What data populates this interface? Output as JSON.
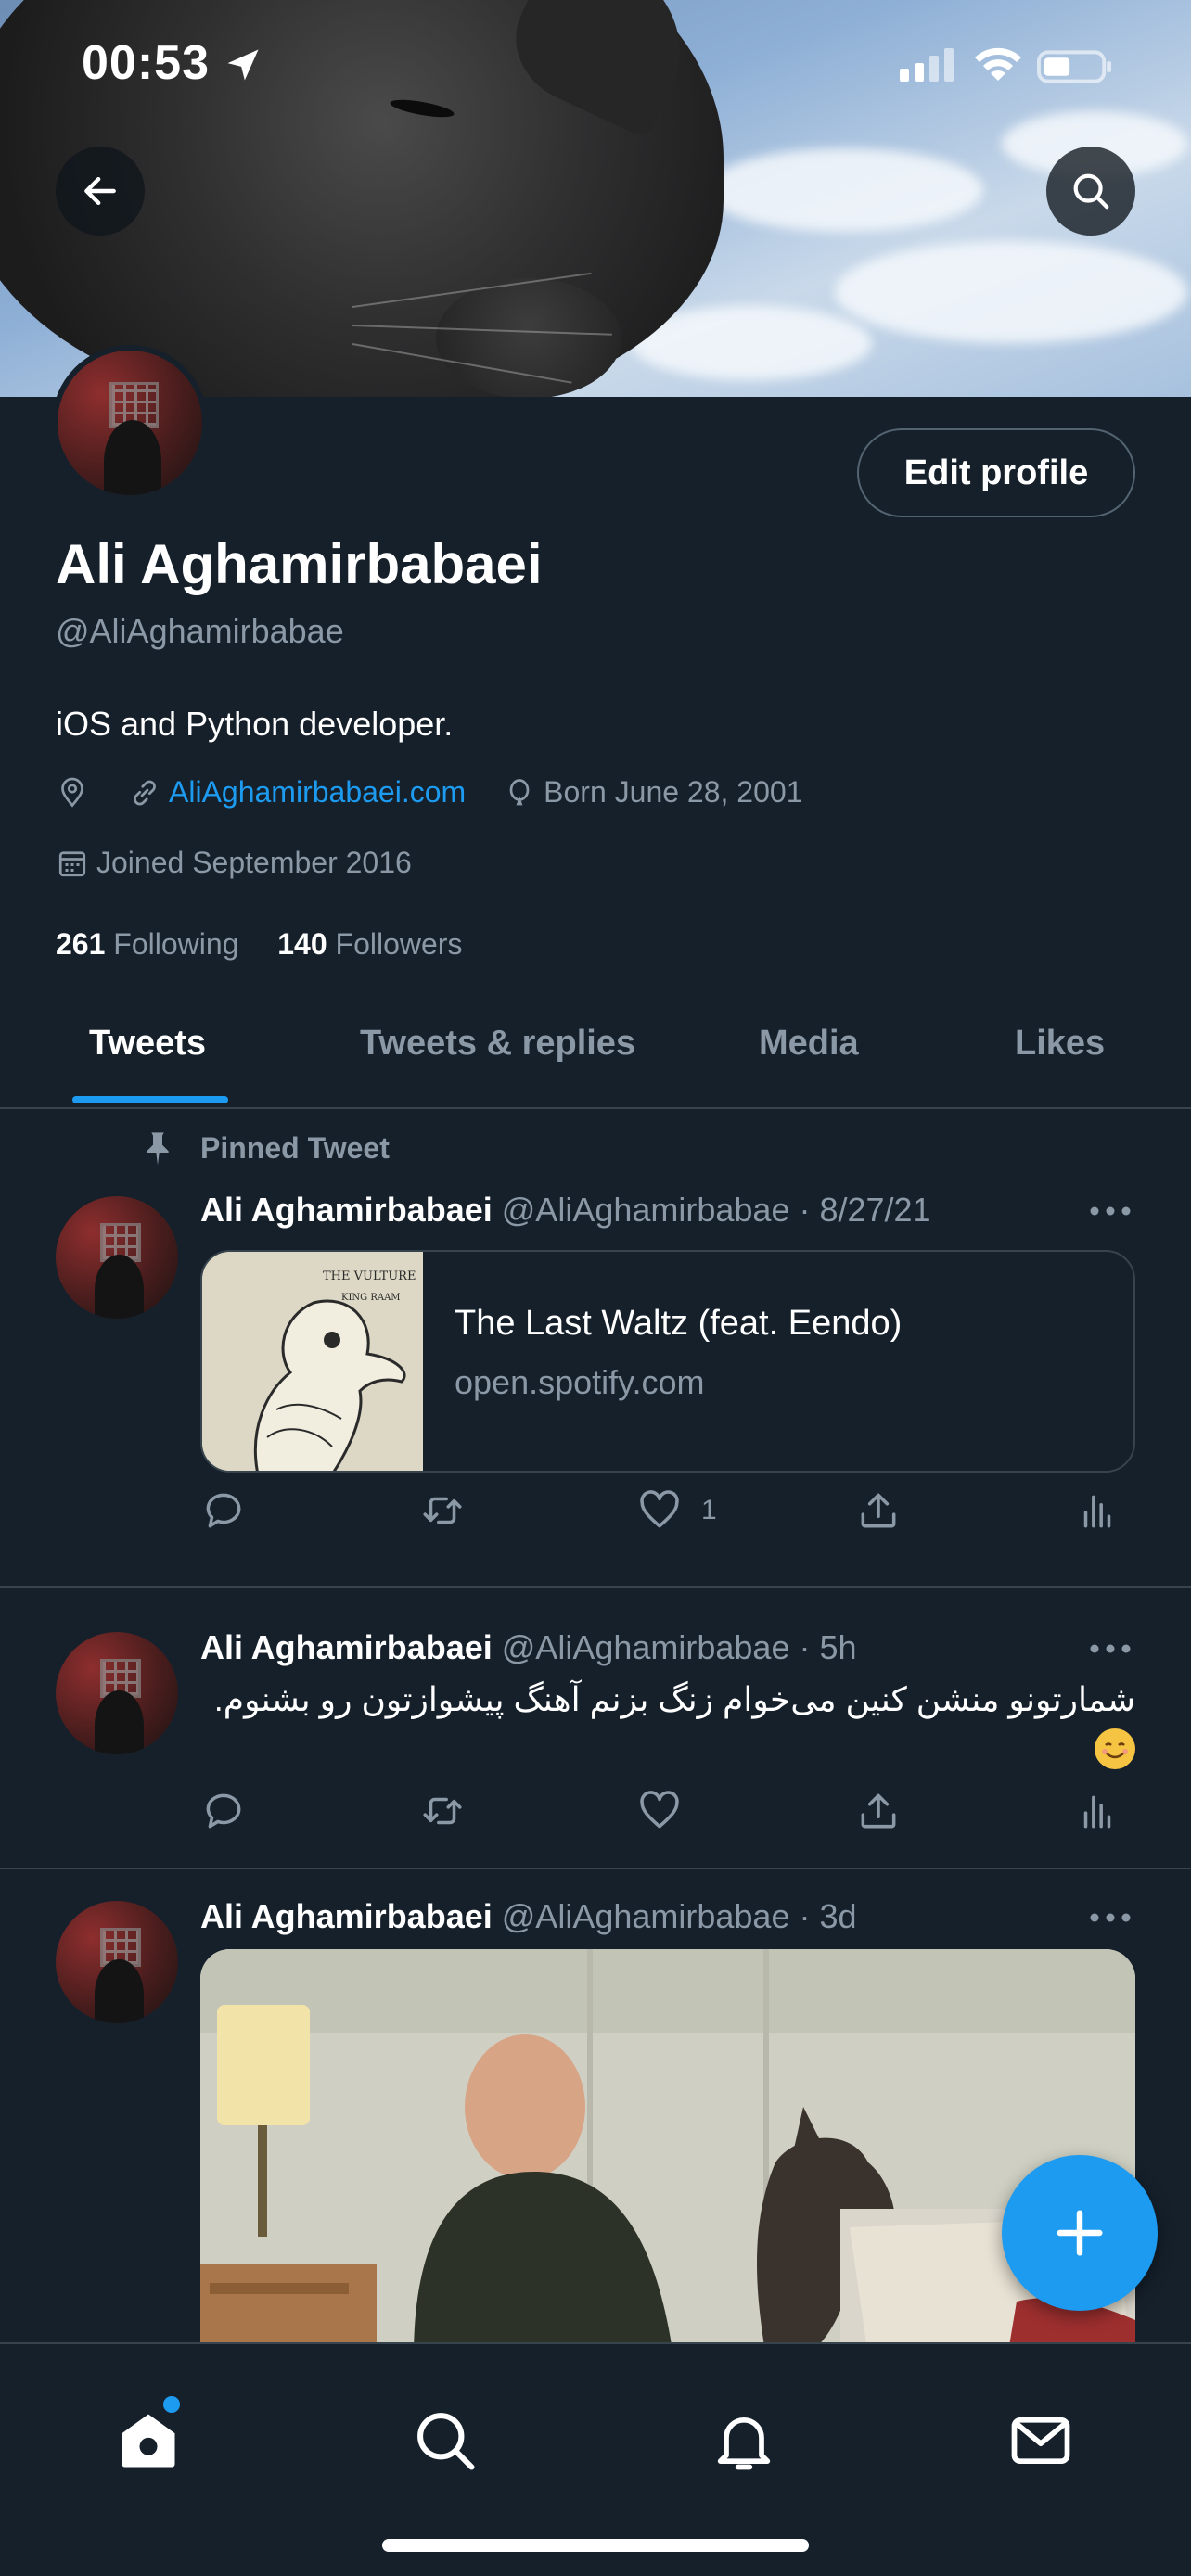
{
  "status": {
    "time": "00:53"
  },
  "profile": {
    "name": "Ali Aghamirbabaei",
    "handle": "@AliAghamirbabae",
    "bio": "iOS and Python developer.",
    "website": "AliAghamirbabaei.com",
    "birthday": "Born June 28, 2001",
    "joined": "Joined September 2016",
    "following_count": "261",
    "following_label": "Following",
    "followers_count": "140",
    "followers_label": "Followers",
    "edit_label": "Edit profile"
  },
  "tabs": [
    {
      "label": "Tweets",
      "active": true
    },
    {
      "label": "Tweets & replies",
      "active": false
    },
    {
      "label": "Media",
      "active": false
    },
    {
      "label": "Likes",
      "active": false
    }
  ],
  "tweets": [
    {
      "pinned_label": "Pinned Tweet",
      "name": "Ali Aghamirbabaei",
      "meta": "@AliAghamirbabae · 8/27/21",
      "card": {
        "title": "The Last Waltz (feat. Eendo)",
        "domain": "open.spotify.com",
        "art_line1": "THE VULTURE",
        "art_line2": "KING RAAM"
      },
      "likes": "1"
    },
    {
      "name": "Ali Aghamirbabaei",
      "meta": "@AliAghamirbabae · 5h",
      "text": "شمارتونو منشن کنین می‌خوام زنگ بزنم آهنگ پیشوازتون رو بشنوم."
    },
    {
      "name": "Ali Aghamirbabaei",
      "meta": "@AliAghamirbabae · 3d"
    }
  ],
  "colors": {
    "background": "#15202b",
    "accent": "#1d9bf0",
    "secondary_text": "#8b98a5",
    "divider": "#38444d"
  },
  "icons": {
    "back": "arrow-left-icon",
    "search": "search-icon",
    "location": "location-pin-icon",
    "link": "link-icon",
    "birthday": "balloon-icon",
    "calendar": "calendar-icon",
    "pin": "pin-icon",
    "reply": "reply-icon",
    "retweet": "retweet-icon",
    "like": "heart-icon",
    "share": "share-icon",
    "analytics": "analytics-icon",
    "compose": "plus-icon",
    "home": "home-icon",
    "explore": "search-icon",
    "notifications": "bell-icon",
    "messages": "mail-icon"
  }
}
